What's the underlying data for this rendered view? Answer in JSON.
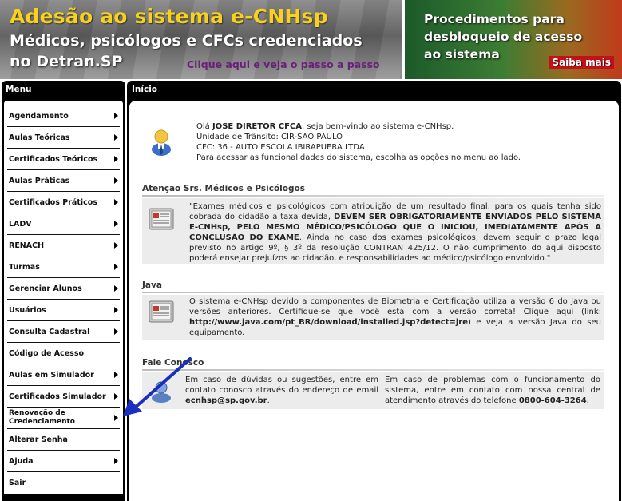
{
  "banner_left": {
    "title": "Adesão ao sistema e-CNHsp",
    "line2": "Médicos, psicólogos e CFCs credenciados",
    "line3": "no Detran.SP",
    "link": "Clique aqui e veja o passo a passo"
  },
  "banner_right": {
    "line1": "Procedimentos para",
    "line2": "desbloqueio de acesso",
    "line3": "ao sistema",
    "link": "Saiba mais"
  },
  "menu": {
    "header": "Menu",
    "items": [
      {
        "label": "Agendamento",
        "arrow": true
      },
      {
        "label": "Aulas Teóricas",
        "arrow": true
      },
      {
        "label": "Certificados Teóricos",
        "arrow": true
      },
      {
        "label": "Aulas Práticas",
        "arrow": true
      },
      {
        "label": "Certificados Práticos",
        "arrow": true
      },
      {
        "label": "LADV",
        "arrow": true
      },
      {
        "label": "RENACH",
        "arrow": true
      },
      {
        "label": "Turmas",
        "arrow": true
      },
      {
        "label": "Gerenciar Alunos",
        "arrow": true
      },
      {
        "label": "Usuários",
        "arrow": true
      },
      {
        "label": "Consulta Cadastral",
        "arrow": true
      },
      {
        "label": "Código de Acesso",
        "arrow": false
      },
      {
        "label": "Aulas em Simulador",
        "arrow": true
      },
      {
        "label": "Certificados Simulador",
        "arrow": true
      },
      {
        "label": "Renovação de\nCredenciamento",
        "arrow": true
      },
      {
        "label": "Alterar Senha",
        "arrow": false
      },
      {
        "label": "Ajuda",
        "arrow": true
      },
      {
        "label": "Sair",
        "arrow": false
      }
    ]
  },
  "content": {
    "header": "Início",
    "welcome": {
      "greeting_prefix": "Olá ",
      "user_name": "JOSE DIRETOR CFCA",
      "greeting_suffix": ", seja bem-vindo ao sistema e-CNHsp.",
      "unit": "Unidade de Trânsito: CIR-SAO PAULO",
      "cfc": "CFC: 36 - AUTO ESCOLA IBIRAPUERA LTDA",
      "instructions": "Para acessar as funcionalidades do sistema, escolha as opções no menu ao lado."
    },
    "attention": {
      "title": "Atenção Srs. Médicos e Psicólogos",
      "text_1": "\"Exames médicos e psicológicos com atribuição de um resultado final, para os quais tenha sido cobrada do cidadão a taxa devida, ",
      "text_bold": "DEVEM SER OBRIGATORIAMENTE ENVIADOS PELO SISTEMA E-CNHsp, PELO MESMO MÉDICO/PSICÓLOGO QUE O INICIOU, IMEDIATAMENTE APÓS A CONCLUSÃO DO EXAME",
      "text_2": ". Ainda no caso dos exames psicológicos, devem seguir o prazo legal previsto no artigo 9º, § 3º da resolução CONTRAN 425/12. O não cumprimento do aqui disposto poderá ensejar prejuízos ao cidadão, e responsabilidades ao médico/psicólogo envolvido.\""
    },
    "java": {
      "title": "Java",
      "text_1": "O sistema e-CNHsp devido a componentes de Biometria e Certificação utiliza a versão 6 do Java ou versões anteriores. Certifique-se que você está com a versão correta! Clique aqui (link: ",
      "link": "http://www.java.com/pt_BR/download/installed.jsp?detect=jre",
      "text_2": ") e veja a versão Java do seu equipamento."
    },
    "contact": {
      "title": "Fale Conosco",
      "col1_text": "Em caso de dúvidas ou sugestões, entre em contato conosco através do endereço de email ",
      "email": "ecnhsp@sp.gov.br",
      "col1_end": ".",
      "col2_text": "Em caso de problemas com o funcionamento do sistema, entre em contato com nossa central de atendimento através do telefone ",
      "phone": "0800-604-3264",
      "col2_end": "."
    }
  },
  "colors": {
    "banner_title": "#f7d11c",
    "banner_link": "#6b1f7a",
    "saiba_mais_bg": "#c1121a",
    "panel_bg": "#000000",
    "box_bg": "#ececec",
    "annotation_arrow": "#1b2fbf"
  }
}
